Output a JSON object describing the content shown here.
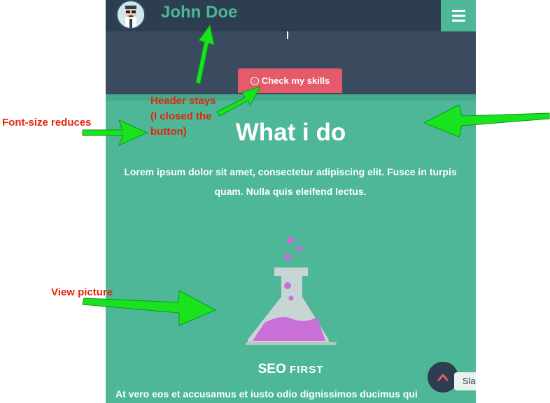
{
  "site": {
    "brand": "John Doe",
    "menu_icon": "hamburger-icon",
    "skills_button": "Check my skills",
    "section_title": "What i do",
    "lead": "Lorem ipsum dolor sit amet, consectetur adipiscing elit. Fusce in turpis quam. Nulla quis eleifend lectus.",
    "feature_title_main": "SEO ",
    "feature_title_small": "FIRST",
    "feature_text": "At vero eos et accusamus et iusto odio dignissimos ducimus qui",
    "chat_label": "Sla",
    "colors": {
      "header": "#2c3e4f",
      "hero": "#3a4b5f",
      "accent": "#4db797",
      "button": "#e55b6b",
      "flask_liquid": "#c86fd8"
    }
  },
  "annotations": {
    "font_size": "Font-size reduces",
    "view_picture": "View picture",
    "header_line1": "Header stays",
    "header_line2": "(I closed the",
    "header_line3": "button)",
    "arrow_color": "#19e31e"
  }
}
